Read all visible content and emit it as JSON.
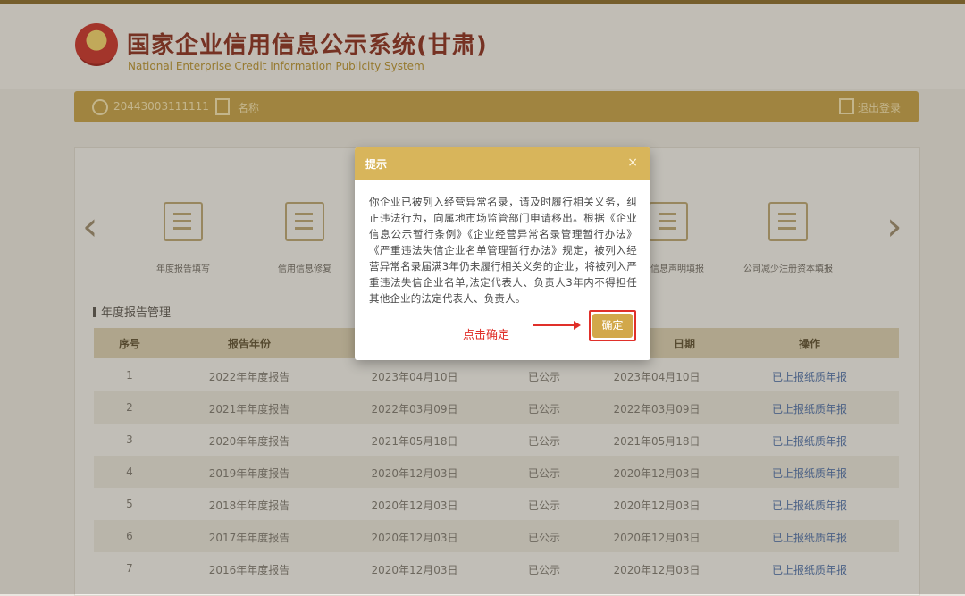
{
  "header": {
    "title_cn": "国家企业信用信息公示系统(甘肃)",
    "title_en": "National Enterprise Credit Information Publicity System",
    "emblem_glyph": "★"
  },
  "userbar": {
    "code": "20443003111111",
    "name": "名称",
    "exit_label": "退出登录"
  },
  "nav": {
    "prev_glyph": "‹",
    "next_glyph": "›",
    "tiles": [
      {
        "label": "年度报告填写"
      },
      {
        "label": "信用信息修复"
      },
      {
        "label": "即时信息声明填报"
      },
      {
        "label": "公司减少注册资本填报"
      }
    ]
  },
  "section_title": "年度报告管理",
  "table": {
    "headers": [
      "序号",
      "报告年份",
      "",
      "",
      "日期",
      "操作"
    ],
    "rows": [
      [
        "1",
        "2022年年度报告",
        "2023年04月10日",
        "已公示",
        "2023年04月10日",
        "已上报纸质年报"
      ],
      [
        "2",
        "2021年年度报告",
        "2022年03月09日",
        "已公示",
        "2022年03月09日",
        "已上报纸质年报"
      ],
      [
        "3",
        "2020年年度报告",
        "2021年05月18日",
        "已公示",
        "2021年05月18日",
        "已上报纸质年报"
      ],
      [
        "4",
        "2019年年度报告",
        "2020年12月03日",
        "已公示",
        "2020年12月03日",
        "已上报纸质年报"
      ],
      [
        "5",
        "2018年年度报告",
        "2020年12月03日",
        "已公示",
        "2020年12月03日",
        "已上报纸质年报"
      ],
      [
        "6",
        "2017年年度报告",
        "2020年12月03日",
        "已公示",
        "2020年12月03日",
        "已上报纸质年报"
      ],
      [
        "7",
        "2016年年度报告",
        "2020年12月03日",
        "已公示",
        "2020年12月03日",
        "已上报纸质年报"
      ]
    ]
  },
  "dialog": {
    "title": "提示",
    "close_glyph": "×",
    "body": "你企业已被列入经营异常名录，请及时履行相关义务，纠正违法行为，向属地市场监管部门申请移出。根据《企业信息公示暂行条例》《企业经营异常名录管理暂行办法》《严重违法失信企业名单管理暂行办法》规定，被列入经营异常名录届满3年仍未履行相关义务的企业，将被列入严重违法失信企业名单,法定代表人、负责人3年内不得担任其他企业的法定代表人、负责人。",
    "hint": "点击确定",
    "ok_label": "确定"
  },
  "colors": {
    "accent": "#c4a047",
    "dialog_header": "#d8b55b",
    "ok_button": "#d2a84a",
    "highlight": "#e0302a",
    "link": "#4e70a8"
  }
}
